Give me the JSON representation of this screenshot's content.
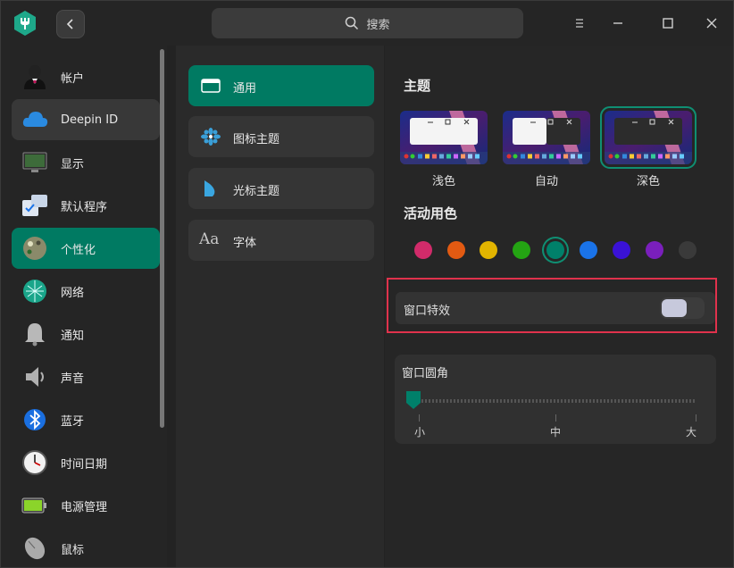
{
  "search": {
    "label": "搜索"
  },
  "sidebar": {
    "items": [
      {
        "label": "帐户",
        "icon": "user-avatar-icon"
      },
      {
        "label": "Deepin ID",
        "icon": "cloud-icon"
      },
      {
        "label": "显示",
        "icon": "monitor-icon"
      },
      {
        "label": "默认程序",
        "icon": "default-apps-icon"
      },
      {
        "label": "个性化",
        "icon": "personalization-icon"
      },
      {
        "label": "网络",
        "icon": "network-icon"
      },
      {
        "label": "通知",
        "icon": "bell-icon"
      },
      {
        "label": "声音",
        "icon": "speaker-icon"
      },
      {
        "label": "蓝牙",
        "icon": "bluetooth-icon"
      },
      {
        "label": "时间日期",
        "icon": "clock-icon"
      },
      {
        "label": "电源管理",
        "icon": "battery-icon"
      },
      {
        "label": "鼠标",
        "icon": "mouse-icon"
      }
    ],
    "active_index": 4,
    "hover_index": 1
  },
  "middle": {
    "items": [
      {
        "label": "通用",
        "icon": "general-window-icon"
      },
      {
        "label": "图标主题",
        "icon": "icon-theme-icon"
      },
      {
        "label": "光标主题",
        "icon": "cursor-theme-icon"
      },
      {
        "label": "字体",
        "icon": "font-icon"
      }
    ],
    "active_index": 0
  },
  "theme": {
    "title": "主题",
    "options": [
      {
        "label": "浅色"
      },
      {
        "label": "自动"
      },
      {
        "label": "深色"
      }
    ],
    "selected_index": 2
  },
  "accent": {
    "title": "活动用色",
    "colors": [
      "#d12b6a",
      "#e25a12",
      "#e2b400",
      "#24a413",
      "#00806a",
      "#1a73e8",
      "#3a12d6",
      "#7a1fbc",
      "#3a3a3a"
    ],
    "selected_index": 4
  },
  "window_effect": {
    "label": "窗口特效",
    "enabled": false
  },
  "corner": {
    "label": "窗口圆角",
    "ticks": [
      "小",
      "中",
      "大"
    ],
    "value_index": 0
  }
}
